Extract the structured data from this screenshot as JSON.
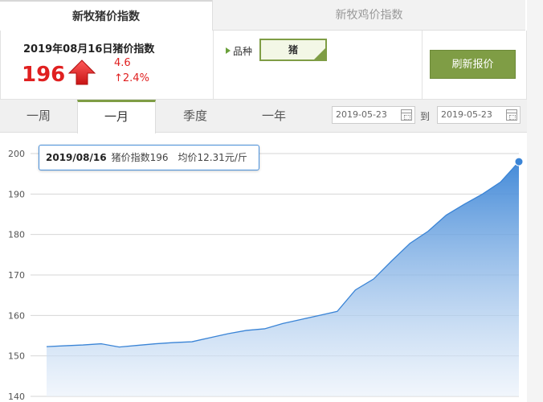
{
  "tabs": {
    "active": "新牧猪价指数",
    "inactive": "新牧鸡价指数"
  },
  "summary": {
    "title": "2019年08月16日猪价指数",
    "index": "196",
    "change": "4.6",
    "pct": "↑2.4%",
    "variety_label": "品种",
    "variety_value": "猪",
    "refresh_label": "刷新报价"
  },
  "periods": [
    "一周",
    "一月",
    "季度",
    "一年"
  ],
  "active_period": "一月",
  "date_range": {
    "from": "2019-05-23",
    "to_label": "到",
    "to": "2019-05-23"
  },
  "tooltip": {
    "date": "2019/08/16",
    "text": "猪价指数196　均价12.31元/斤"
  },
  "colors": {
    "accent_green": "#7f9d45",
    "up_red": "#e02020",
    "line_blue": "#3a84d6"
  },
  "icons": {
    "up_arrow": "up-arrow-icon",
    "calendar": "calendar-icon",
    "check": "check-icon"
  },
  "chart_data": {
    "type": "area",
    "title": "",
    "xlabel": "",
    "ylabel": "",
    "ylim": [
      140,
      200
    ],
    "yticks": [
      140,
      150,
      160,
      170,
      180,
      190,
      200
    ],
    "grid": true,
    "series": [
      {
        "values": [
          152.3,
          152.5,
          152.7,
          153.0,
          152.2,
          152.6,
          153.0,
          153.3,
          153.5,
          154.5,
          155.5,
          156.3,
          156.7,
          158.0,
          159.0,
          160.0,
          161.0,
          166.3,
          169.0,
          173.5,
          177.8,
          180.8,
          184.8,
          187.5,
          190.0,
          193.0,
          198.0
        ]
      }
    ]
  }
}
